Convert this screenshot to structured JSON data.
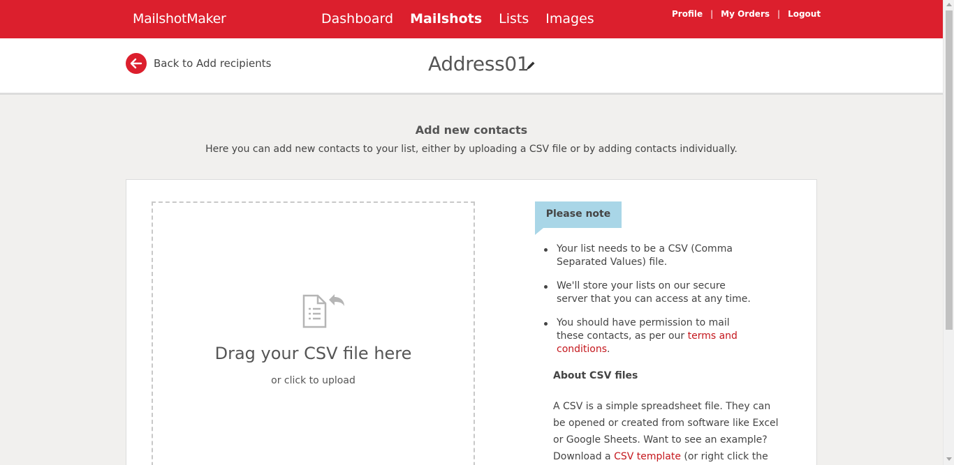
{
  "nav": {
    "brand": "MailshotMaker",
    "main": [
      {
        "label": "Dashboard",
        "active": false
      },
      {
        "label": "Mailshots",
        "active": true
      },
      {
        "label": "Lists",
        "active": false
      },
      {
        "label": "Images",
        "active": false
      }
    ],
    "user": [
      "Profile",
      "My Orders",
      "Logout"
    ],
    "separator": "|"
  },
  "subheader": {
    "back_label": "Back to Add recipients",
    "title": "Address01"
  },
  "intro": {
    "heading": "Add new contacts",
    "text": "Here you can add new contacts to your list, either by uploading a CSV file or by adding contacts individually."
  },
  "upload": {
    "title": "Drag your CSV file here",
    "subtitle": "or click to upload"
  },
  "note": {
    "badge": "Please note",
    "items": [
      {
        "text": "Your list needs to be a CSV (Comma Separated Values) file."
      },
      {
        "text": "We'll store your lists on our secure server that you can access at any time."
      },
      {
        "text_before": "You should have permission to mail these contacts, as per our ",
        "link": "terms and conditions",
        "text_after": "."
      }
    ]
  },
  "about": {
    "heading": "About CSV files",
    "text_before": "A CSV is a simple spreadsheet file. They can be opened or created from software like Excel or Google Sheets. Want to see an example? Download a ",
    "link": "CSV template",
    "text_after": " (or right click the link"
  },
  "colors": {
    "brand_red": "#dc1f2d",
    "link_red": "#c4161c",
    "note_blue": "#a9d6e7",
    "background": "#f1f0ee"
  },
  "icons": [
    "back-arrow-icon",
    "pencil-icon",
    "csv-file-upload-icon"
  ]
}
